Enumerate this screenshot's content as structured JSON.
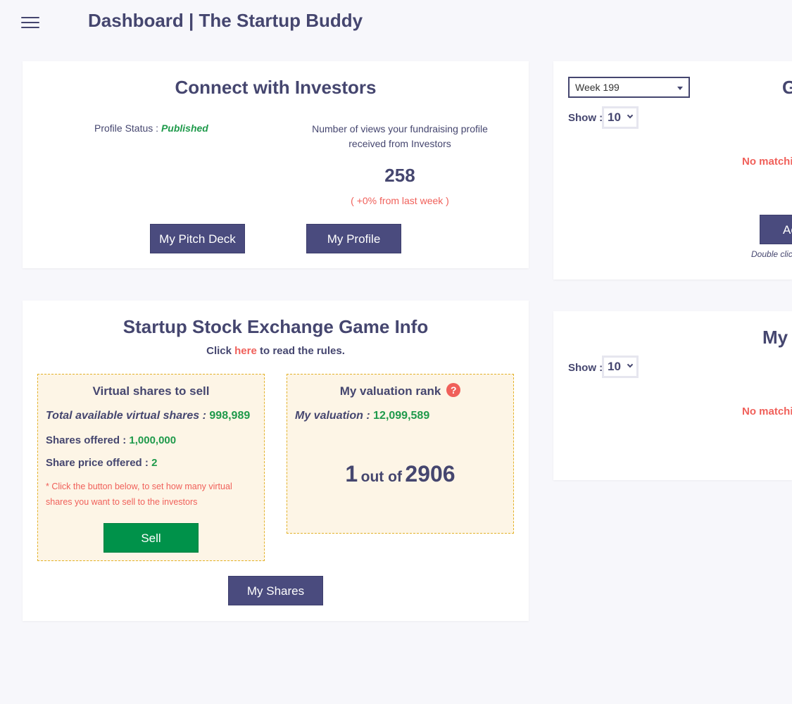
{
  "header": {
    "title": "Dashboard | The Startup Buddy",
    "menu_icon": "hamburger-menu-icon"
  },
  "investors_card": {
    "title": "Connect with Investors",
    "profile_status_label": "Profile Status :",
    "profile_status_value": "Published",
    "views_label_line1": "Number of views your fundraising profile",
    "views_label_line2": "received from Investors",
    "views_count": "258",
    "views_change": "( +0% from last week )",
    "pitch_deck_button": "My Pitch Deck",
    "profile_button": "My Profile"
  },
  "game_card": {
    "title": "Startup Stock Exchange Game Info",
    "rules_prefix": "Click",
    "rules_link": "here",
    "rules_suffix": "to read the rules.",
    "shares_box": {
      "title": "Virtual shares to sell",
      "total_label": "Total available virtual shares :",
      "total_value": "998,989",
      "offered_label": "Shares offered :",
      "offered_value": "1,000,000",
      "price_label": "Share price offered :",
      "price_value": "2",
      "note_line1": "* Click the button below, to set how many virtual",
      "note_line2": "shares you want to sell to the investors",
      "sell_button": "Sell"
    },
    "rank_box": {
      "title": "My valuation rank",
      "help_icon": "?",
      "valuation_label": "My valuation :",
      "valuation_value": "12,099,589",
      "rank": "1",
      "out_of": "out of",
      "total": "2906"
    },
    "my_shares_button": "My Shares"
  },
  "right_card_top": {
    "week_select_value": "Week 199",
    "title_fragment": "G",
    "show_label": "Show :",
    "show_value": "10",
    "empty_message": "No matchi",
    "button_fragment": "Ac",
    "hint_fragment": "Double clic"
  },
  "right_card_bottom": {
    "title_fragment": "My",
    "show_label": "Show :",
    "show_value": "10",
    "empty_message": "No matchi"
  },
  "colors": {
    "primary": "#4a4b7e",
    "accent_green": "#00924a",
    "accent_red": "#f0605a",
    "background": "#f7f7fb"
  }
}
